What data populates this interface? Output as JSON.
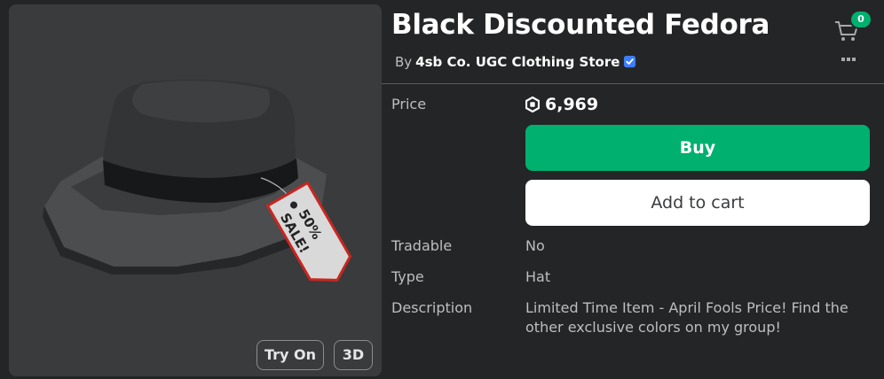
{
  "item": {
    "title": "Black Discounted Fedora",
    "creator_prefix": "By",
    "creator_name": "4sb Co. UGC Clothing Store",
    "image_tag_text": "50% SALE!"
  },
  "preview_buttons": {
    "try_on": "Try On",
    "three_d": "3D"
  },
  "header": {
    "cart_count": "0"
  },
  "details": {
    "price_label": "Price",
    "price_value": "6,969",
    "buy_label": "Buy",
    "add_to_cart_label": "Add to cart",
    "tradable_label": "Tradable",
    "tradable_value": "No",
    "type_label": "Type",
    "type_value": "Hat",
    "description_label": "Description",
    "description_value": "Limited Time Item - April Fools Price! Find the other exclusive colors on my group!"
  },
  "icons": {
    "cart": "shopping-cart-icon",
    "more": "more-options-icon",
    "verified": "verified-badge-icon",
    "currency": "robux-icon"
  },
  "colors": {
    "background": "#232527",
    "panel": "#393b3d",
    "accent_green": "#00b06f",
    "verified_blue": "#3d7eff",
    "title": "#ffffff",
    "muted_text": "#bdbebe"
  }
}
